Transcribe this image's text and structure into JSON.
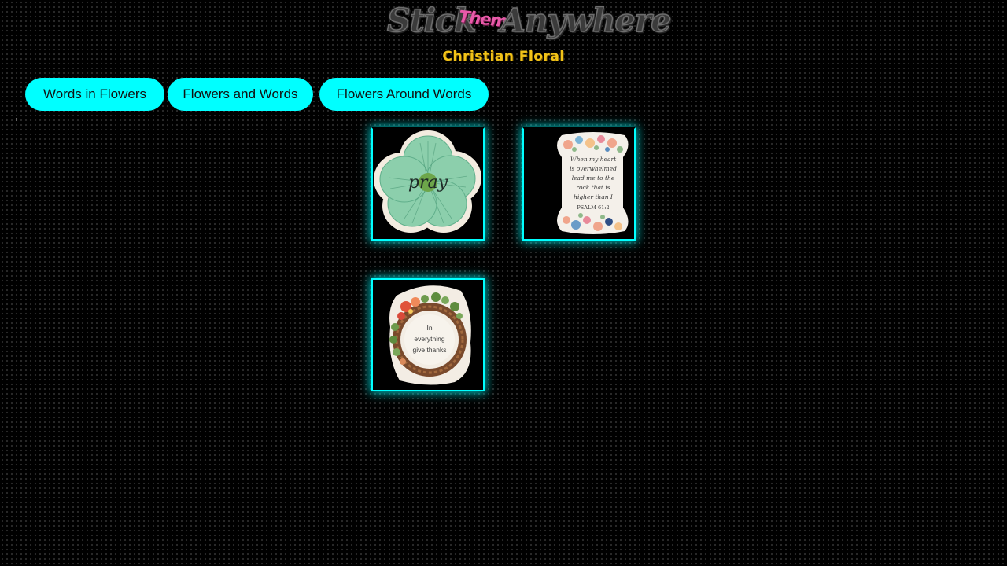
{
  "logo": {
    "word1": "Stick",
    "word2": "Them",
    "word3": "Anywhere"
  },
  "subtitle": "Christian Floral",
  "nav": {
    "buttons": [
      {
        "label": "Words in Flowers"
      },
      {
        "label": "Flowers and Words"
      },
      {
        "label": "Flowers Around Words"
      }
    ]
  },
  "stickers": [
    {
      "text": "pray"
    },
    {
      "lines": [
        "When my heart",
        "is overwhelmed",
        "lead me to the",
        "rock that is",
        "higher than I",
        "PSALM 61:2"
      ]
    },
    {
      "lines": [
        "In",
        "everything",
        "give thanks"
      ]
    }
  ],
  "colors": {
    "accent": "#00ffff",
    "subtitle": "#f2c318",
    "logo_them": "#e85aa9"
  }
}
